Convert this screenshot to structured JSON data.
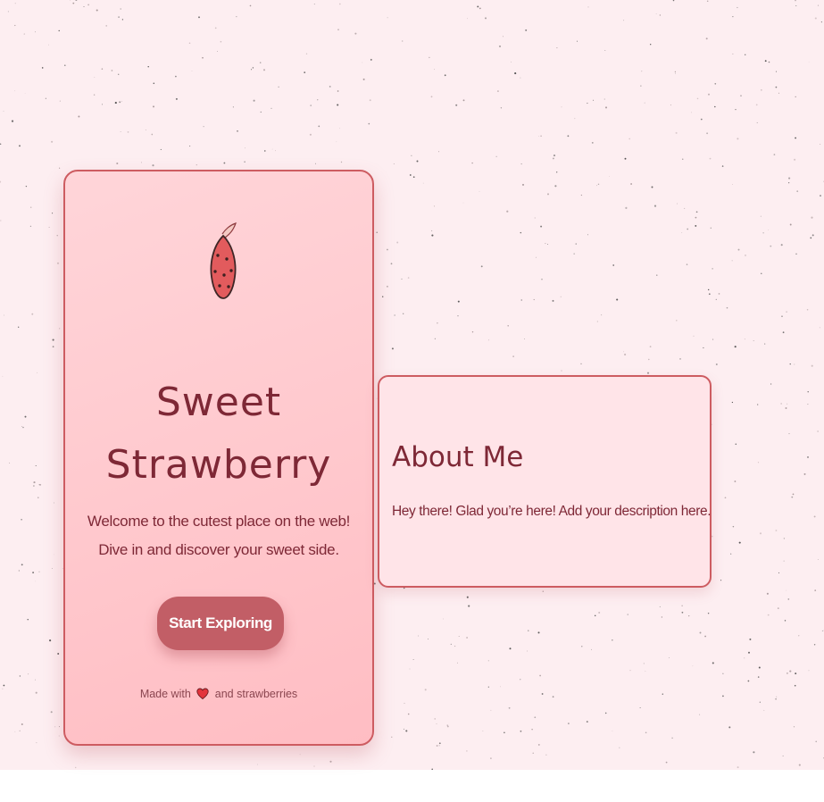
{
  "colors": {
    "page_background": "#fdeef1",
    "card_background": "#ffc8cd",
    "card_border": "#cd5c61",
    "text_primary": "#7e2836",
    "button_background": "#c25e66",
    "button_text": "#ffffff",
    "about_background": "#ffe4e8"
  },
  "hero": {
    "icon": "strawberry-icon",
    "title_line1": "Sweet",
    "title_line2": "Strawberry",
    "tagline_line1": "Welcome to the cutest place on the web!",
    "tagline_line2": "Dive in and discover your sweet side.",
    "cta_label": "Start Exploring",
    "footer_prefix": "Made with",
    "footer_icon": "heart-icon",
    "footer_suffix": "and strawberries"
  },
  "about": {
    "title": "About Me",
    "text": "Hey there! Glad you’re here! Add your description here."
  }
}
